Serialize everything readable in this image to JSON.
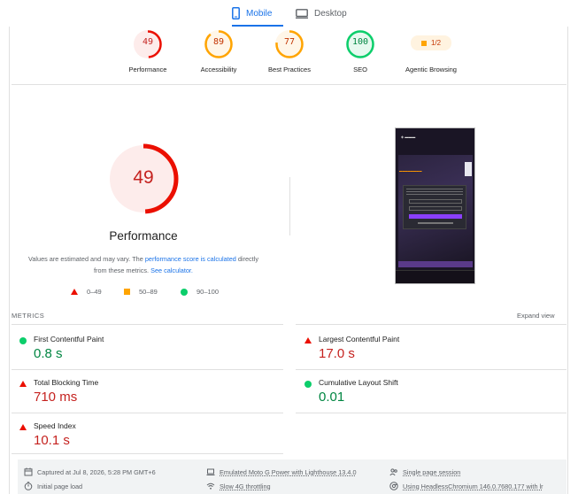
{
  "tabs": [
    {
      "label": "Mobile",
      "icon": "smartphone-icon",
      "active": true
    },
    {
      "label": "Desktop",
      "icon": "monitor-icon",
      "active": false
    }
  ],
  "categories": [
    {
      "label": "Performance",
      "score": "49",
      "status": "fail"
    },
    {
      "label": "Accessibility",
      "score": "89",
      "status": "average"
    },
    {
      "label": "Best Practices",
      "score": "77",
      "status": "average"
    },
    {
      "label": "SEO",
      "score": "100",
      "status": "pass"
    },
    {
      "label": "Agentic Browsing",
      "score": "1/2",
      "status": "average"
    }
  ],
  "performance": {
    "score": "49",
    "title": "Performance",
    "desc_prefix": "Values are estimated and may vary. The ",
    "desc_link1": "performance score is calculated",
    "desc_middle": " directly from these metrics. ",
    "desc_link2": "See calculator."
  },
  "legend": [
    {
      "range": "0–49",
      "shape": "triangle"
    },
    {
      "range": "50–89",
      "shape": "square"
    },
    {
      "range": "90–100",
      "shape": "circle"
    }
  ],
  "metrics": {
    "title": "METRICS",
    "expand_label": "Expand view",
    "items": [
      {
        "name": "First Contentful Paint",
        "value": "0.8 s",
        "status": "pass"
      },
      {
        "name": "Largest Contentful Paint",
        "value": "17.0 s",
        "status": "fail"
      },
      {
        "name": "Total Blocking Time",
        "value": "710 ms",
        "status": "fail"
      },
      {
        "name": "Cumulative Layout Shift",
        "value": "0.01",
        "status": "pass"
      },
      {
        "name": "Speed Index",
        "value": "10.1 s",
        "status": "fail"
      }
    ]
  },
  "footer": {
    "captured": "Captured at Jul 8, 2026, 5:28 PM GMT+6",
    "initial_load": "Initial page load",
    "device": "Emulated Moto G Power with Lighthouse 13.4.0",
    "throttling": "Slow 4G throttling",
    "session": "Single page session",
    "browser": "Using HeadlessChromium 146.0.7680.177 with lr"
  },
  "colors": {
    "fail": "#eb0f00",
    "average": "#ffa400",
    "pass": "#0cce6b",
    "accent": "#1a73e8"
  }
}
